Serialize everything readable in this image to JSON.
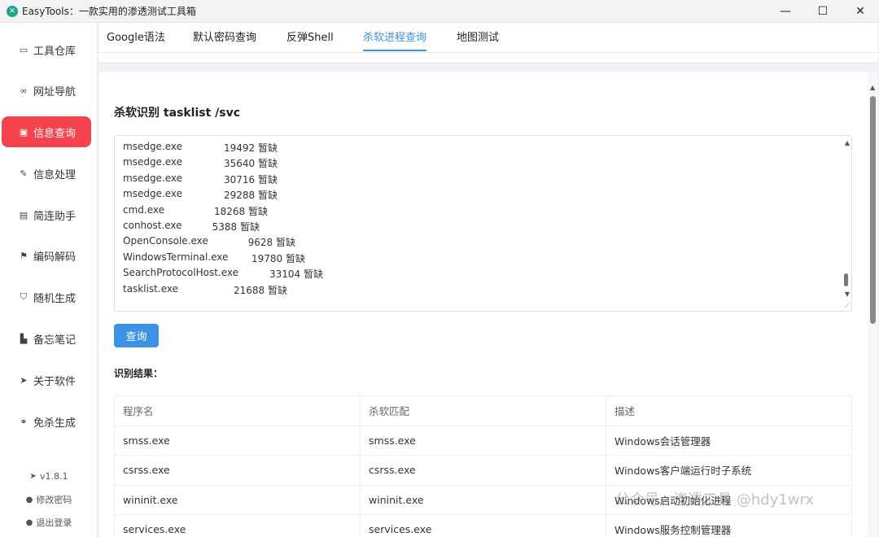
{
  "window": {
    "title": "EasyTools：一款实用的渗透测试工具箱",
    "controls": [
      "—",
      "☐",
      "✕"
    ]
  },
  "sidebar": {
    "items": [
      {
        "label": "工具仓库",
        "icon": "box-icon"
      },
      {
        "label": "网址导航",
        "icon": "link-icon"
      },
      {
        "label": "信息查询",
        "icon": "search-doc-icon",
        "active": true
      },
      {
        "label": "信息处理",
        "icon": "edit-icon"
      },
      {
        "label": "简连助手",
        "icon": "memo-icon"
      },
      {
        "label": "编码解码",
        "icon": "flag-icon"
      },
      {
        "label": "随机生成",
        "icon": "shield-icon"
      },
      {
        "label": "备忘笔记",
        "icon": "book-icon"
      },
      {
        "label": "关于软件",
        "icon": "send-icon"
      },
      {
        "label": "免杀生成",
        "icon": "chain-icon"
      }
    ],
    "version": "v1.8.1",
    "change_password": "修改密码",
    "logout": "退出登录"
  },
  "tabs": [
    {
      "label": "Google语法"
    },
    {
      "label": "默认密码查询"
    },
    {
      "label": "反弹Shell"
    },
    {
      "label": "杀软进程查询",
      "active": true
    },
    {
      "label": "地图测试"
    }
  ],
  "main": {
    "title": "杀软识别 tasklist /svc",
    "tasklist_lines": [
      {
        "name": "msedge.exe",
        "pid": "19492",
        "svc": "暂缺"
      },
      {
        "name": "msedge.exe",
        "pid": "35640",
        "svc": "暂缺"
      },
      {
        "name": "msedge.exe",
        "pid": "30716",
        "svc": "暂缺"
      },
      {
        "name": "msedge.exe",
        "pid": "29288",
        "svc": "暂缺"
      },
      {
        "name": "cmd.exe",
        "pid": "18268",
        "svc": "暂缺"
      },
      {
        "name": "conhost.exe",
        "pid": "5388",
        "svc": "暂缺"
      },
      {
        "name": "OpenConsole.exe",
        "pid": "9628",
        "svc": "暂缺"
      },
      {
        "name": "WindowsTerminal.exe",
        "pid": "19780",
        "svc": "暂缺"
      },
      {
        "name": "SearchProtocolHost.exe",
        "pid": "33104",
        "svc": "暂缺"
      },
      {
        "name": "tasklist.exe",
        "pid": "21688",
        "svc": "暂缺"
      }
    ],
    "query_button": "查询",
    "result_label": "识别结果：",
    "table": {
      "columns": [
        "程序名",
        "杀软匹配",
        "描述"
      ],
      "rows": [
        [
          "smss.exe",
          "smss.exe",
          "Windows会话管理器"
        ],
        [
          "csrss.exe",
          "csrss.exe",
          "Windows客户端运行时子系统"
        ],
        [
          "wininit.exe",
          "wininit.exe",
          "Windows启动初始化进程"
        ],
        [
          "services.exe",
          "services.exe",
          "Windows服务控制管理器"
        ]
      ]
    }
  },
  "watermark": "公众号 · 渗透工具 @hdy1wrx"
}
